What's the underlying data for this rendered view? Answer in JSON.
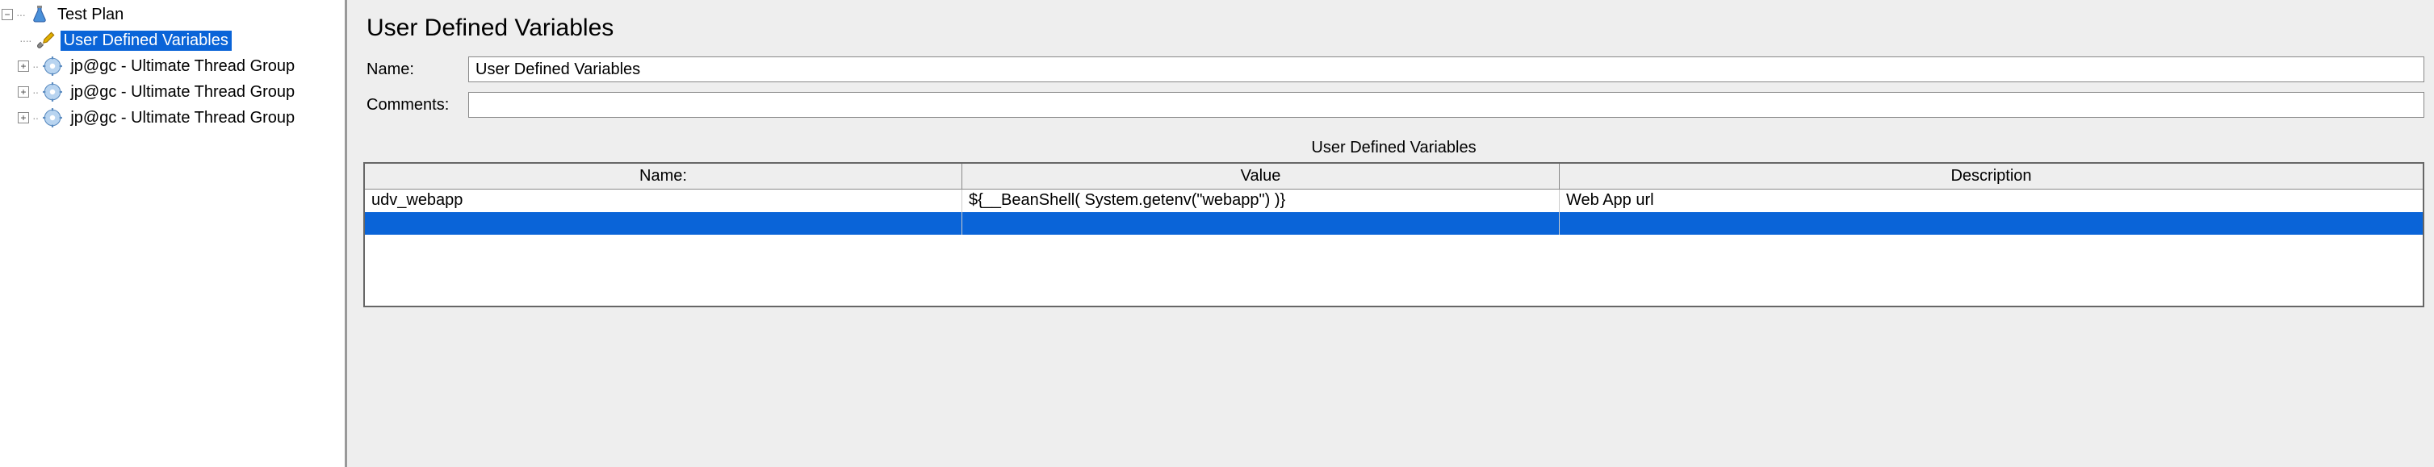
{
  "tree": {
    "root": "Test Plan",
    "items": [
      {
        "label": "User Defined Variables",
        "selected": true
      },
      {
        "label": "jp@gc - Ultimate Thread Group",
        "selected": false
      },
      {
        "label": "jp@gc - Ultimate Thread Group",
        "selected": false
      },
      {
        "label": "jp@gc - Ultimate Thread Group",
        "selected": false
      }
    ]
  },
  "panel": {
    "title": "User Defined Variables",
    "name_label": "Name:",
    "name_value": "User Defined Variables",
    "comments_label": "Comments:",
    "comments_value": "",
    "section_title": "User Defined Variables",
    "columns": {
      "name": "Name:",
      "value": "Value",
      "desc": "Description"
    },
    "rows": [
      {
        "name": "udv_webapp",
        "value": "${__BeanShell( System.getenv(\"webapp\") )}",
        "desc": "Web App url"
      }
    ]
  }
}
